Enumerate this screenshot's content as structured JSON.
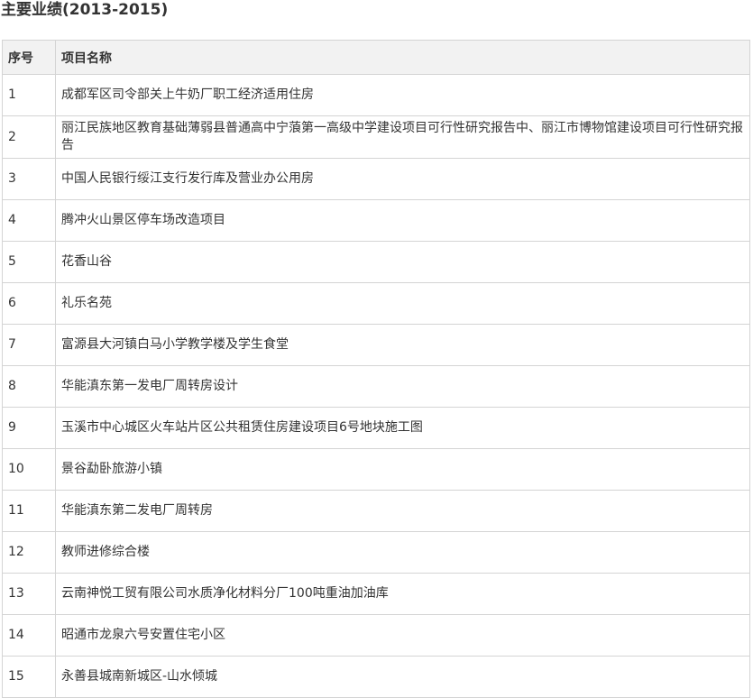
{
  "page_title": "主要业绩(2013-2015)",
  "table": {
    "headers": {
      "no": "序号",
      "name": "项目名称"
    },
    "rows": [
      {
        "no": "1",
        "name": "成都军区司令部关上牛奶厂职工经济适用住房"
      },
      {
        "no": "2",
        "name": "丽江民族地区教育基础薄弱县普通高中宁蒗第一高级中学建设项目可行性研究报告中、丽江市博物馆建设项目可行性研究报告"
      },
      {
        "no": "3",
        "name": "中国人民银行绥江支行发行库及营业办公用房"
      },
      {
        "no": "4",
        "name": "腾冲火山景区停车场改造项目"
      },
      {
        "no": "5",
        "name": "花香山谷"
      },
      {
        "no": "6",
        "name": "礼乐名苑"
      },
      {
        "no": "7",
        "name": "富源县大河镇白马小学教学楼及学生食堂"
      },
      {
        "no": "8",
        "name": "华能滇东第一发电厂周转房设计"
      },
      {
        "no": "9",
        "name": "玉溪市中心城区火车站片区公共租赁住房建设项目6号地块施工图"
      },
      {
        "no": "10",
        "name": "景谷勐卧旅游小镇"
      },
      {
        "no": "11",
        "name": "华能滇东第二发电厂周转房"
      },
      {
        "no": "12",
        "name": "教师进修综合楼"
      },
      {
        "no": "13",
        "name": "云南神悦工贸有限公司水质净化材料分厂100吨重油加油库"
      },
      {
        "no": "14",
        "name": "昭通市龙泉六号安置住宅小区"
      },
      {
        "no": "15",
        "name": "永善县城南新城区-山水倾城"
      }
    ]
  }
}
